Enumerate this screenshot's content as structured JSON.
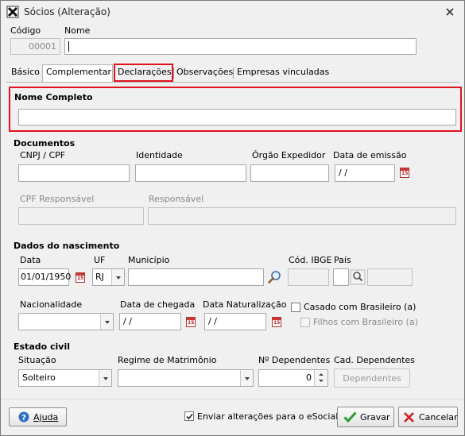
{
  "window": {
    "title": "Sócios (Alteração)"
  },
  "header": {
    "codigo_label": "Código",
    "codigo_value": "00001",
    "nome_label": "Nome",
    "nome_value": ""
  },
  "tabs": [
    {
      "label": "Básico"
    },
    {
      "label": "Complementar"
    },
    {
      "label": "Declarações"
    },
    {
      "label": "Observações"
    },
    {
      "label": "Empresas vinculadas"
    }
  ],
  "nome_completo": {
    "label": "Nome Completo",
    "value": ""
  },
  "documentos": {
    "title": "Documentos",
    "cnpj_label": "CNPJ / CPF",
    "identidade_label": "Identidade",
    "orgao_label": "Órgão Expedidor",
    "data_emissao_label": "Data de emissão",
    "data_emissao_value": " / /",
    "cpf_resp_label": "CPF Responsável",
    "responsavel_label": "Responsável"
  },
  "nascimento": {
    "title": "Dados do nascimento",
    "data_label": "Data",
    "data_value": "01/01/1950",
    "uf_label": "UF",
    "uf_value": "RJ",
    "municipio_label": "Município",
    "ibge_label": "Cód. IBGE",
    "pais_label": "País",
    "nacionalidade_label": "Nacionalidade",
    "chegada_label": "Data de chegada",
    "chegada_value": " / /",
    "naturalizacao_label": "Data Naturalização",
    "naturalizacao_value": " / /",
    "casado_label": "Casado com Brasileiro (a)",
    "filhos_label": "Filhos com Brasileiro (a)"
  },
  "estado_civil": {
    "title": "Estado civil",
    "situacao_label": "Situação",
    "situacao_value": "Solteiro",
    "regime_label": "Regime de Matrimônio",
    "dependentes_label": "Nº Dependentes",
    "dependentes_value": "0",
    "cad_dep_label": "Cad. Dependentes",
    "dep_button": "Dependentes"
  },
  "footer": {
    "ajuda": "Ajuda",
    "enviar_label": "Enviar alterações para o eSocial",
    "gravar": "Gravar",
    "cancelar": "Cancelar"
  },
  "colors": {
    "highlight": "#e0141e",
    "ok_green": "#2d9a2d",
    "cancel_red": "#d02020",
    "help_blue": "#2f6fc4"
  }
}
